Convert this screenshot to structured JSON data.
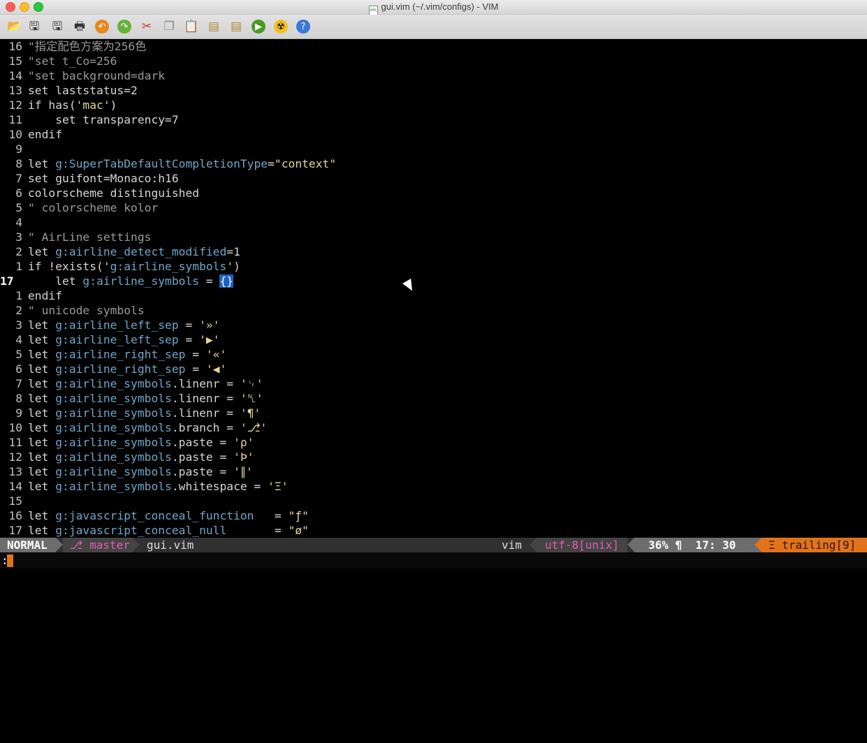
{
  "window": {
    "title": "gui.vim (~/.vim/configs) - VIM"
  },
  "toolbar": {
    "icons": [
      "open-file-icon",
      "save-icon",
      "save-all-icon",
      "print-icon",
      "undo-icon",
      "redo-icon",
      "cut-icon",
      "copy-icon",
      "paste-icon",
      "load-session-icon",
      "save-session-icon",
      "run-icon",
      "radioactive-icon",
      "help-icon"
    ]
  },
  "editor": {
    "lines": [
      {
        "num": "16",
        "text": "\"指定配色方案为256色",
        "kind": "comment"
      },
      {
        "num": "15",
        "text": "\"set t_Co=256",
        "kind": "comment"
      },
      {
        "num": "14",
        "text": "\"set background=dark",
        "kind": "comment"
      },
      {
        "num": "13",
        "text": "set laststatus=2",
        "kind": "code"
      },
      {
        "num": "12",
        "text": "if has('mac')",
        "kind": "code"
      },
      {
        "num": "11",
        "text": "    set transparency=7",
        "kind": "code"
      },
      {
        "num": "10",
        "text": "endif",
        "kind": "code"
      },
      {
        "num": "9",
        "text": "",
        "kind": "code"
      },
      {
        "num": "8",
        "text": "let g:SuperTabDefaultCompletionType=\"context\"",
        "kind": "code"
      },
      {
        "num": "7",
        "text": "set guifont=Monaco:h16",
        "kind": "code"
      },
      {
        "num": "6",
        "text": "colorscheme distinguished",
        "kind": "code"
      },
      {
        "num": "5",
        "text": "\" colorscheme kolor",
        "kind": "comment"
      },
      {
        "num": "4",
        "text": "",
        "kind": "code"
      },
      {
        "num": "3",
        "text": "\" AirLine settings",
        "kind": "comment"
      },
      {
        "num": "2",
        "text": "let g:airline_detect_modified=1",
        "kind": "code"
      },
      {
        "num": "1",
        "text": "if !exists('g:airline_symbols')",
        "kind": "code"
      },
      {
        "num": "17",
        "text": "    let g:airline_symbols = {}",
        "kind": "current"
      },
      {
        "num": "1",
        "text": "endif",
        "kind": "code"
      },
      {
        "num": "2",
        "text": "\" unicode symbols",
        "kind": "comment"
      },
      {
        "num": "3",
        "text": "let g:airline_left_sep = '»'",
        "kind": "code"
      },
      {
        "num": "4",
        "text": "let g:airline_left_sep = '▶'",
        "kind": "code"
      },
      {
        "num": "5",
        "text": "let g:airline_right_sep = '«'",
        "kind": "code"
      },
      {
        "num": "6",
        "text": "let g:airline_right_sep = '◀'",
        "kind": "code"
      },
      {
        "num": "7",
        "text": "let g:airline_symbols.linenr = '␊'",
        "kind": "code"
      },
      {
        "num": "8",
        "text": "let g:airline_symbols.linenr = '␤'",
        "kind": "code"
      },
      {
        "num": "9",
        "text": "let g:airline_symbols.linenr = '¶'",
        "kind": "code"
      },
      {
        "num": "10",
        "text": "let g:airline_symbols.branch = '⎇'",
        "kind": "code"
      },
      {
        "num": "11",
        "text": "let g:airline_symbols.paste = 'ρ'",
        "kind": "code"
      },
      {
        "num": "12",
        "text": "let g:airline_symbols.paste = 'Þ'",
        "kind": "code"
      },
      {
        "num": "13",
        "text": "let g:airline_symbols.paste = '∥'",
        "kind": "code"
      },
      {
        "num": "14",
        "text": "let g:airline_symbols.whitespace = 'Ξ'",
        "kind": "code"
      },
      {
        "num": "15",
        "text": "",
        "kind": "code"
      },
      {
        "num": "16",
        "text": "let g:javascript_conceal_function   = \"ƒ\"",
        "kind": "code"
      },
      {
        "num": "17",
        "text": "let g:javascript_conceal_null       = \"ø\"",
        "kind": "code"
      }
    ]
  },
  "statusline": {
    "mode": "NORMAL",
    "branch": "⎇ master",
    "file": "gui.vim",
    "filetype": "vim",
    "encoding": "utf-8[unix]",
    "position": "36% ¶  17: 30",
    "warning": "Ξ trailing[9]",
    "colors": {
      "mode_bg": "#6d6d6d",
      "accent": "#e05fb0",
      "warning_bg": "#e2731a"
    }
  },
  "cmdline": {
    "text": ":"
  }
}
